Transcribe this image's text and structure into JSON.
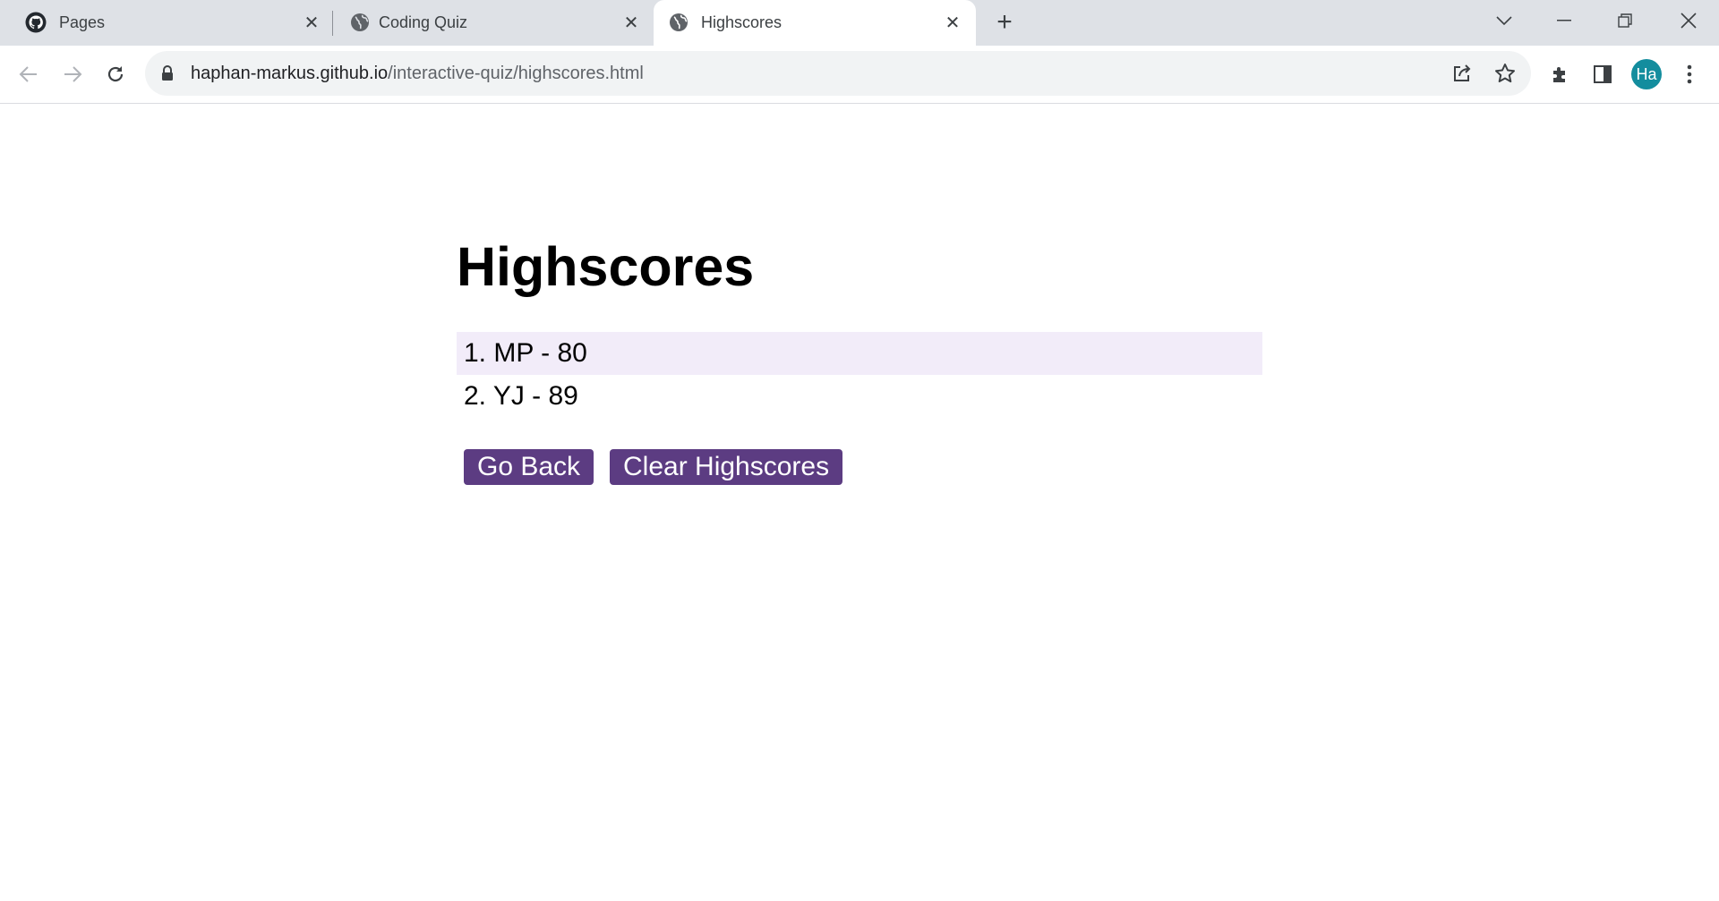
{
  "browser": {
    "tabs": [
      {
        "title": "Pages",
        "icon": "github-icon"
      },
      {
        "title": "Coding Quiz",
        "icon": "globe-icon"
      },
      {
        "title": "Highscores",
        "icon": "globe-icon",
        "active": true
      }
    ],
    "url_host": "haphan-markus.github.io",
    "url_path": "/interactive-quiz/highscores.html",
    "profile_initials": "Ha",
    "profile_color": "#138d9e"
  },
  "page": {
    "title": "Highscores",
    "scores": [
      {
        "text": "1. MP - 80"
      },
      {
        "text": "2. YJ - 89"
      }
    ],
    "go_back_label": "Go Back",
    "clear_label": "Clear Highscores",
    "accent_color": "#5c3c82",
    "row_highlight_color": "#f2ecf9"
  }
}
